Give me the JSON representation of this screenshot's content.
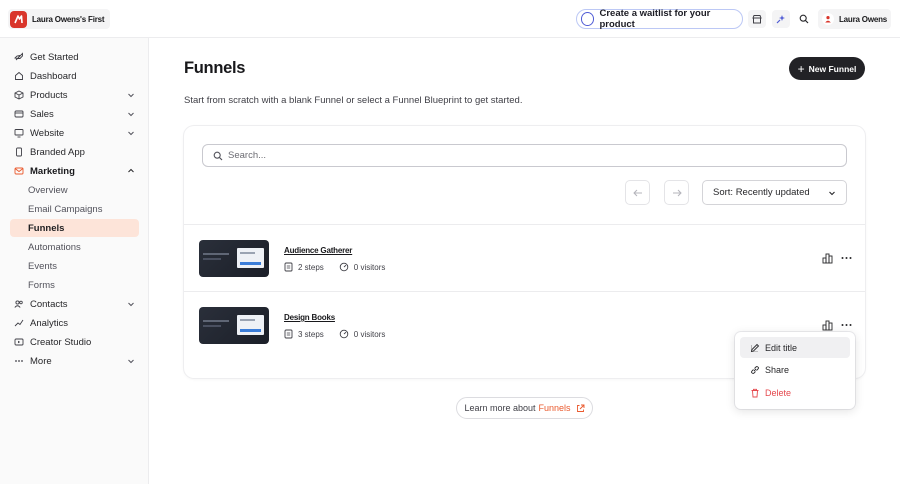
{
  "topbar": {
    "workspace_name": "Laura Owens's First",
    "waitlist_label": "Create a waitlist for your product",
    "user_name": "Laura Owens",
    "icons": [
      "store-icon",
      "sparkle-icon",
      "search-icon"
    ]
  },
  "sidebar": {
    "items": [
      {
        "label": "Get Started",
        "icon": "rocket-icon"
      },
      {
        "label": "Dashboard",
        "icon": "home-icon"
      },
      {
        "label": "Products",
        "icon": "box-icon",
        "chevron": "down"
      },
      {
        "label": "Sales",
        "icon": "wallet-icon",
        "chevron": "down"
      },
      {
        "label": "Website",
        "icon": "monitor-icon",
        "chevron": "down"
      },
      {
        "label": "Branded App",
        "icon": "phone-icon"
      },
      {
        "label": "Marketing",
        "icon": "mail-icon",
        "chevron": "up"
      }
    ],
    "marketing_sub": [
      "Overview",
      "Email Campaigns",
      "Funnels",
      "Automations",
      "Events",
      "Forms"
    ],
    "items_after": [
      {
        "label": "Contacts",
        "icon": "users-icon",
        "chevron": "down"
      },
      {
        "label": "Analytics",
        "icon": "chart-icon"
      },
      {
        "label": "Creator Studio",
        "icon": "studio-icon"
      },
      {
        "label": "More",
        "icon": "dots-icon",
        "chevron": "down"
      }
    ],
    "active_sub": "Funnels"
  },
  "main": {
    "title": "Funnels",
    "new_button": "New Funnel",
    "subtitle": "Start from scratch with a blank Funnel or select a Funnel Blueprint to get started.",
    "search_placeholder": "Search...",
    "sort_label": "Sort: Recently updated",
    "funnels": [
      {
        "title": "Audience Gatherer",
        "steps": "2 steps",
        "visitors": "0 visitors"
      },
      {
        "title": "Design Books",
        "steps": "3 steps",
        "visitors": "0 visitors"
      }
    ],
    "context_menu": [
      "Edit title",
      "Share",
      "Delete"
    ],
    "learn_prefix": "Learn more about",
    "learn_link": "Funnels"
  },
  "colors": {
    "accent": "#ea5a2e",
    "active_bg": "#fde4d9",
    "brand_logo": "#d9352b",
    "danger": "#e5484d",
    "primary_button": "#222226"
  }
}
